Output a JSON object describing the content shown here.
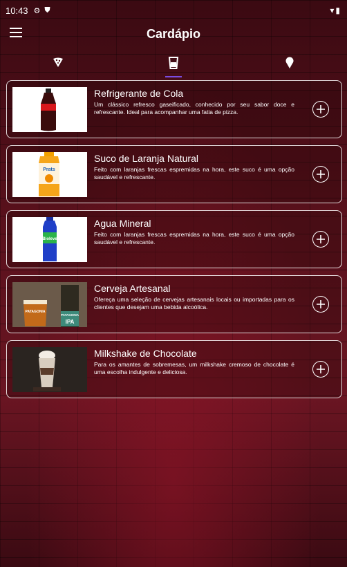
{
  "status": {
    "time": "10:43"
  },
  "appbar": {
    "title": "Cardápio"
  },
  "tabs": [
    {
      "icon": "pizza-icon",
      "active": false
    },
    {
      "icon": "drink-icon",
      "active": true
    },
    {
      "icon": "ice-cream-icon",
      "active": false
    }
  ],
  "items": [
    {
      "name": "Refrigerante de Cola",
      "description": "Um clássico refresco gaseificado, conhecido por seu sabor doce e refrescante. Ideal para acompanhar uma fatia de pizza."
    },
    {
      "name": "Suco de Laranja Natural",
      "description": "Feito com laranjas frescas espremidas na hora, este suco é uma opção saudável e refrescante."
    },
    {
      "name": "Agua Mineral",
      "description": "Feito com laranjas frescas espremidas na hora, este suco é uma opção saudável e refrescante."
    },
    {
      "name": "Cerveja Artesanal",
      "description": "Ofereça uma seleção de cervejas artesanais locais ou importadas para os clientes que desejam uma bebida alcoólica."
    },
    {
      "name": "Milkshake de Chocolate",
      "description": "Para os amantes de sobremesas, um milkshake cremoso de chocolate é uma escolha indulgente e deliciosa."
    }
  ],
  "product_labels": {
    "water_brand": "Bioleve",
    "juice_brand": "Prats",
    "beer_brand_1": "PATAGONIA",
    "beer_brand_2": "PATAGONIA",
    "beer_style": "IPA"
  }
}
